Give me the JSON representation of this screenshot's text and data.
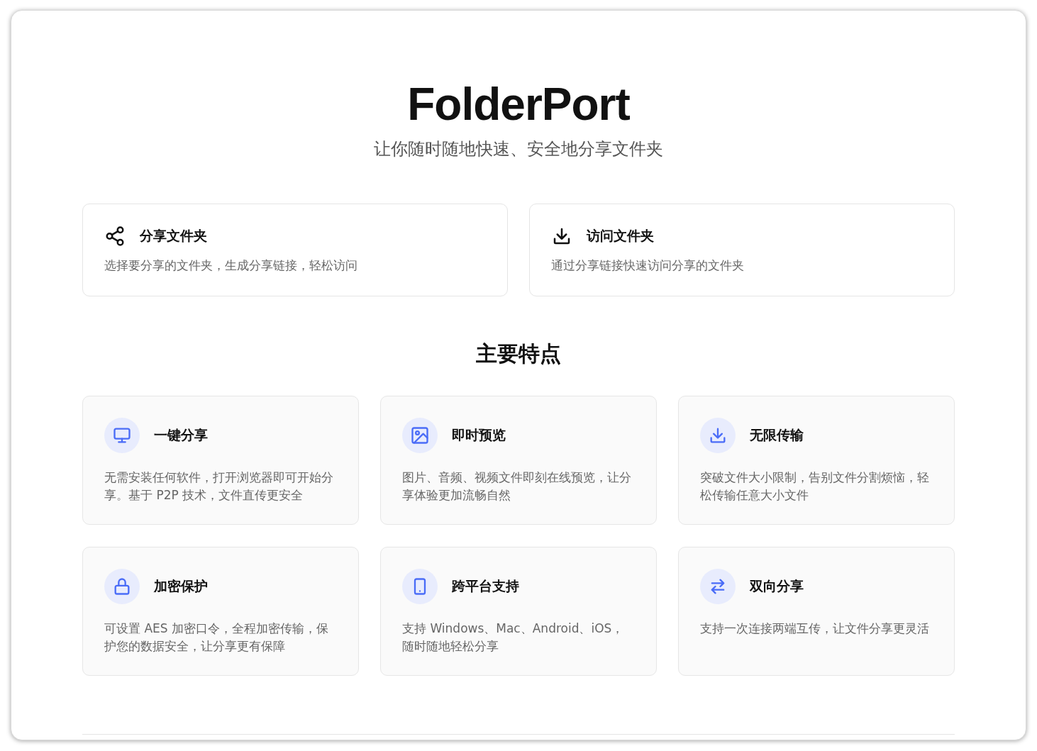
{
  "title": "FolderPort",
  "subtitle": "让你随时随地快速、安全地分享文件夹",
  "actions": [
    {
      "title": "分享文件夹",
      "description": "选择要分享的文件夹，生成分享链接，轻松访问"
    },
    {
      "title": "访问文件夹",
      "description": "通过分享链接快速访问分享的文件夹"
    }
  ],
  "features_heading": "主要特点",
  "features": [
    {
      "title": "一键分享",
      "description": "无需安装任何软件，打开浏览器即可开始分享。基于 P2P 技术，文件直传更安全"
    },
    {
      "title": "即时预览",
      "description": "图片、音频、视频文件即刻在线预览，让分享体验更加流畅自然"
    },
    {
      "title": "无限传输",
      "description": "突破文件大小限制，告别文件分割烦恼，轻松传输任意大小文件"
    },
    {
      "title": "加密保护",
      "description": "可设置 AES 加密口令，全程加密传输，保护您的数据安全，让分享更有保障"
    },
    {
      "title": "跨平台支持",
      "description": "支持 Windows、Mac、Android、iOS，随时随地轻松分享"
    },
    {
      "title": "双向分享",
      "description": "支持一次连接两端互传，让文件分享更灵活"
    }
  ]
}
